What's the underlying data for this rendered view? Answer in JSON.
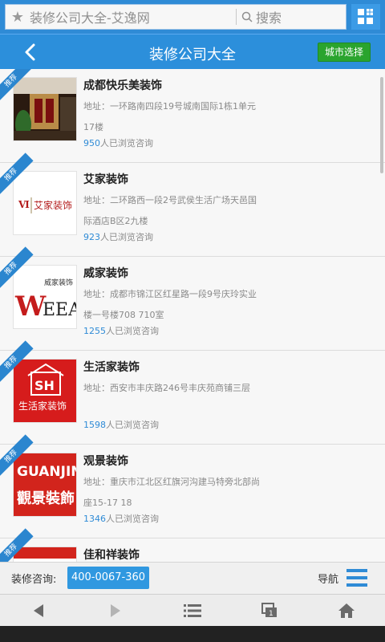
{
  "browser": {
    "url": "装修公司大全-艾逸网",
    "search_placeholder": "搜索"
  },
  "header": {
    "title": "装修公司大全",
    "city_button": "城市选择"
  },
  "ribbon_label": "推荐",
  "companies": [
    {
      "name": "成都快乐美装饰",
      "address": "地址：一环路南四段19号城南国际1栋1单元17楼",
      "views_count": "950",
      "views_suffix": "人已浏览咨询"
    },
    {
      "name": "艾家装饰",
      "address": "地址：二环路西一段2号武侯生活广场天邑国际酒店B区2九楼",
      "views_count": "923",
      "views_suffix": "人已浏览咨询"
    },
    {
      "name": "威家装饰",
      "address": "地址：成都市锦江区红星路一段9号庆玲实业楼一号楼708 710室",
      "views_count": "1255",
      "views_suffix": "人已浏览咨询"
    },
    {
      "name": "生活家装饰",
      "address": "地址：西安市丰庆路246号丰庆苑商铺三层",
      "views_count": "1598",
      "views_suffix": "人已浏览咨询"
    },
    {
      "name": "观景装饰",
      "address": "地址：重庆市江北区红旗河沟建马特旁北部尚座15-17 18",
      "views_count": "1346",
      "views_suffix": "人已浏览咨询"
    },
    {
      "name": "佳和祥装饰",
      "address": "",
      "views_count": "",
      "views_suffix": ""
    }
  ],
  "logos": {
    "aijia": "艾家装饰",
    "weea": "WEEA",
    "weea_small": "威家装饰",
    "sh": "SH",
    "shenghuojia": "生活家装饰",
    "guanjing_en": "GUANJING",
    "guanjing_cn": "觀景裝飾"
  },
  "footer": {
    "consult_label": "装修咨询:",
    "phone": "400-0067-360",
    "nav_label": "导航"
  },
  "colors": {
    "primary": "#2c8fdb",
    "city_button": "#2aa42e",
    "ribbon": "#2b86cf"
  }
}
